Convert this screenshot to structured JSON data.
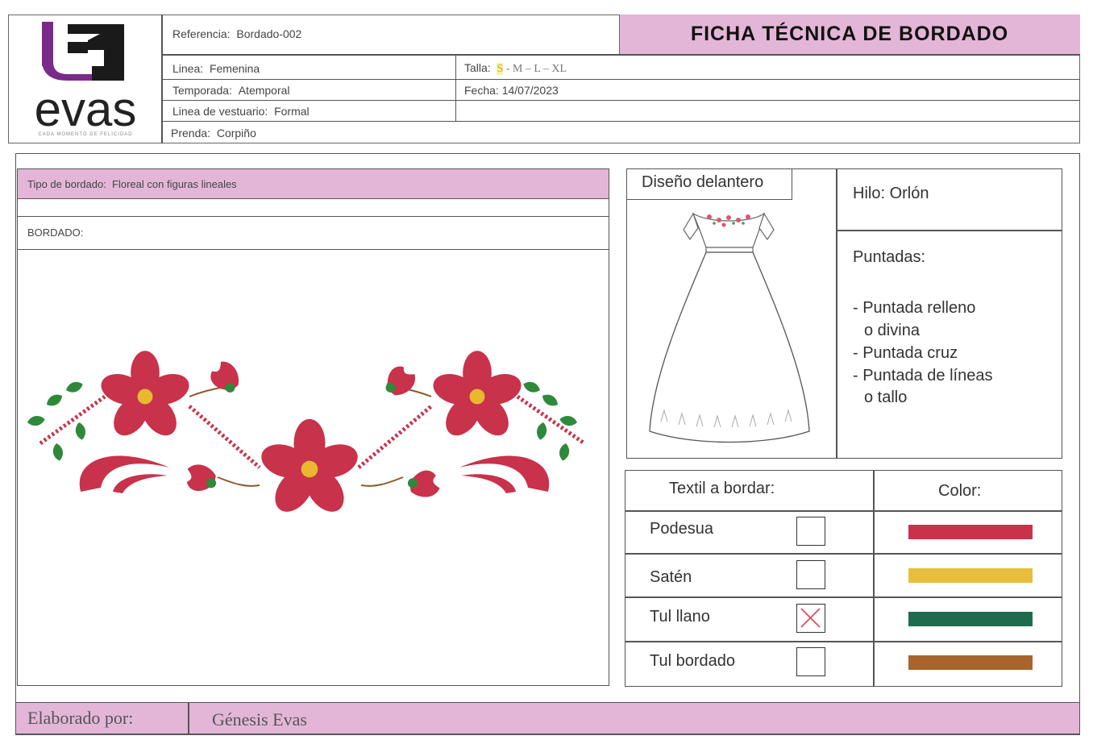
{
  "logo": {
    "brand": "evas",
    "tagline": "CADA MOMENTO DE FELICIDAD"
  },
  "header": {
    "title": "FICHA TÉCNICA DE BORDADO",
    "referencia_label": "Referencia:",
    "referencia_value": "Bordado-002",
    "linea_label": "Linea:",
    "linea_value": "Femenina",
    "temporada_label": "Temporada:",
    "temporada_value": "Atemporal",
    "vestuario_label": "Linea de vestuario:",
    "vestuario_value": "Formal",
    "prenda_label": "Prenda:",
    "prenda_value": "Corpiño",
    "talla_label": "Talla:",
    "talla_selected": "S",
    "talla_rest": " - M – L – XL",
    "fecha_label": "Fecha:",
    "fecha_value": "14/07/2023"
  },
  "embroidery": {
    "tipo_label": "Tipo de bordado:",
    "tipo_value": "Floreal con figuras lineales",
    "bordado_label": "BORDADO:"
  },
  "design": {
    "delantero_label": "Diseño delantero",
    "hilo": "Hilo: Orlón",
    "puntadas_title": "Puntadas:",
    "puntadas": [
      "- Puntada relleno",
      "o divina",
      "- Puntada cruz",
      "- Puntada de líneas",
      "o tallo"
    ]
  },
  "textiles": {
    "header_textil": "Textil a bordar:",
    "header_color": "Color:",
    "items": [
      {
        "name": "Podesua",
        "checked": false
      },
      {
        "name": "Satén",
        "checked": false
      },
      {
        "name": "Tul llano",
        "checked": true
      },
      {
        "name": "Tul bordado",
        "checked": false
      }
    ],
    "colors": [
      "#c8324a",
      "#e8be3c",
      "#1f6b4e",
      "#a8642a"
    ]
  },
  "footer": {
    "label": "Elaborado por:",
    "value": "Génesis Evas"
  },
  "palette": {
    "flower": "#c8324a",
    "leaf": "#2e8a3a",
    "center": "#e8b830",
    "stem": "#8a5a2a",
    "header_pink": "#e3b6d8"
  }
}
